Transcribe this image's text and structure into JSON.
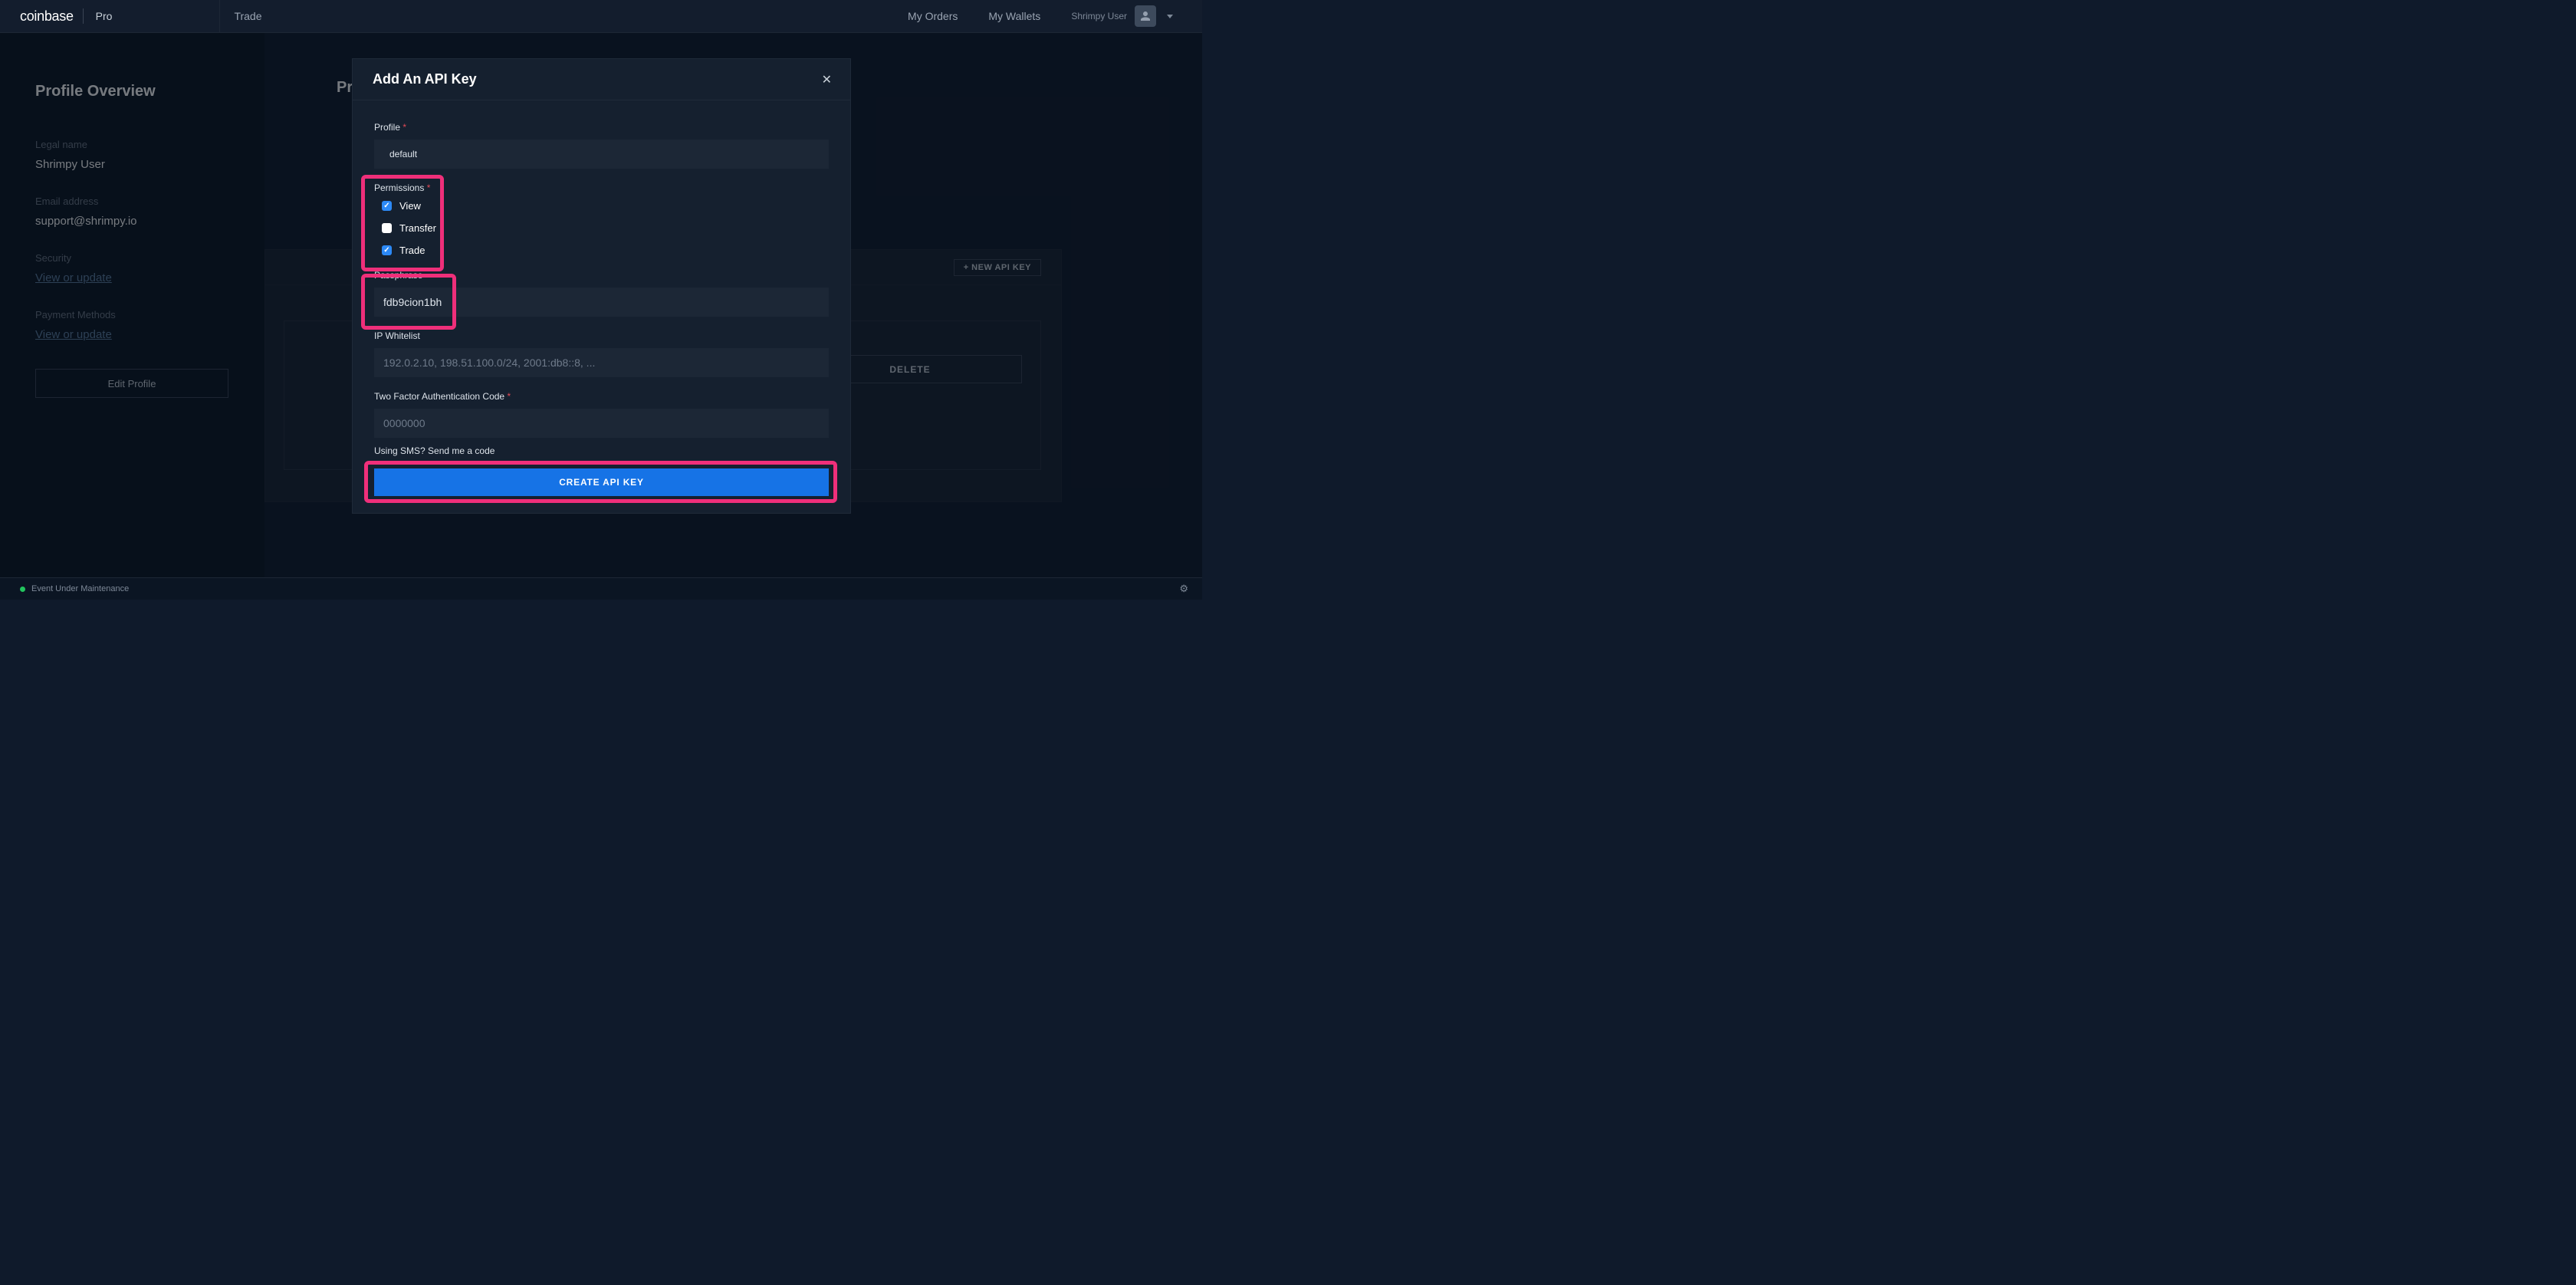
{
  "header": {
    "logo": "coinbase",
    "pro": "Pro",
    "trade": "Trade",
    "my_orders": "My Orders",
    "my_wallets": "My Wallets",
    "user_name": "Shrimpy User"
  },
  "sidebar": {
    "title": "Profile Overview",
    "legal_label": "Legal name",
    "legal_value": "Shrimpy User",
    "email_label": "Email address",
    "email_value": "support@shrimpy.io",
    "security_label": "Security",
    "security_link": "View or update",
    "payment_label": "Payment Methods",
    "payment_link": "View or update",
    "edit_button": "Edit Profile"
  },
  "content": {
    "partial_title": "Pr",
    "new_api_btn": "+ NEW API KEY",
    "delete_btn": "DELETE"
  },
  "modal": {
    "title": "Add An API Key",
    "profile_label": "Profile",
    "profile_value": "default",
    "permissions_label": "Permissions",
    "perm_view": "View",
    "perm_transfer": "Transfer",
    "perm_trade": "Trade",
    "passphrase_label": "Passphrase",
    "passphrase_value": "fdb9cion1bh",
    "ip_label": "IP Whitelist",
    "ip_placeholder": "192.0.2.10, 198.51.100.0/24, 2001:db8::8, ...",
    "tfa_label": "Two Factor Authentication Code",
    "tfa_placeholder": "0000000",
    "sms_link": "Using SMS? Send me a code",
    "create_btn": "CREATE API KEY"
  },
  "status": {
    "text": "Event Under Maintenance"
  }
}
